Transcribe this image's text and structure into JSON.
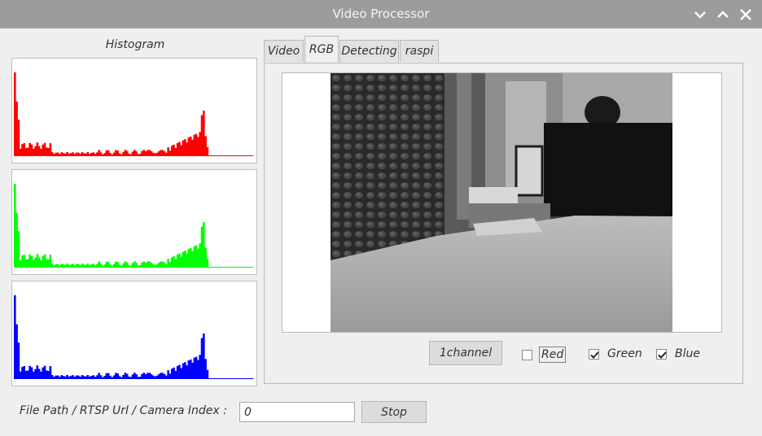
{
  "window": {
    "title": "Video Processor"
  },
  "histogram": {
    "label": "Histogram",
    "colors": {
      "red": "#ff0000",
      "green": "#00ff00",
      "blue": "#0000ff"
    }
  },
  "tabs": [
    {
      "label": "Video"
    },
    {
      "label": "RGB"
    },
    {
      "label": "Detecting"
    },
    {
      "label": "raspi"
    }
  ],
  "rgb_tab": {
    "channel_button": "1channel",
    "checkboxes": [
      {
        "label": "Red",
        "checked": false
      },
      {
        "label": "Green",
        "checked": true
      },
      {
        "label": "Blue",
        "checked": true
      }
    ]
  },
  "source": {
    "label": "File Path / RTSP Url / Camera Index :",
    "value": "0",
    "stop_button": "Stop"
  },
  "icons": {
    "minimize": "chevron-down-icon",
    "maximize": "chevron-up-icon",
    "close": "close-icon"
  }
}
